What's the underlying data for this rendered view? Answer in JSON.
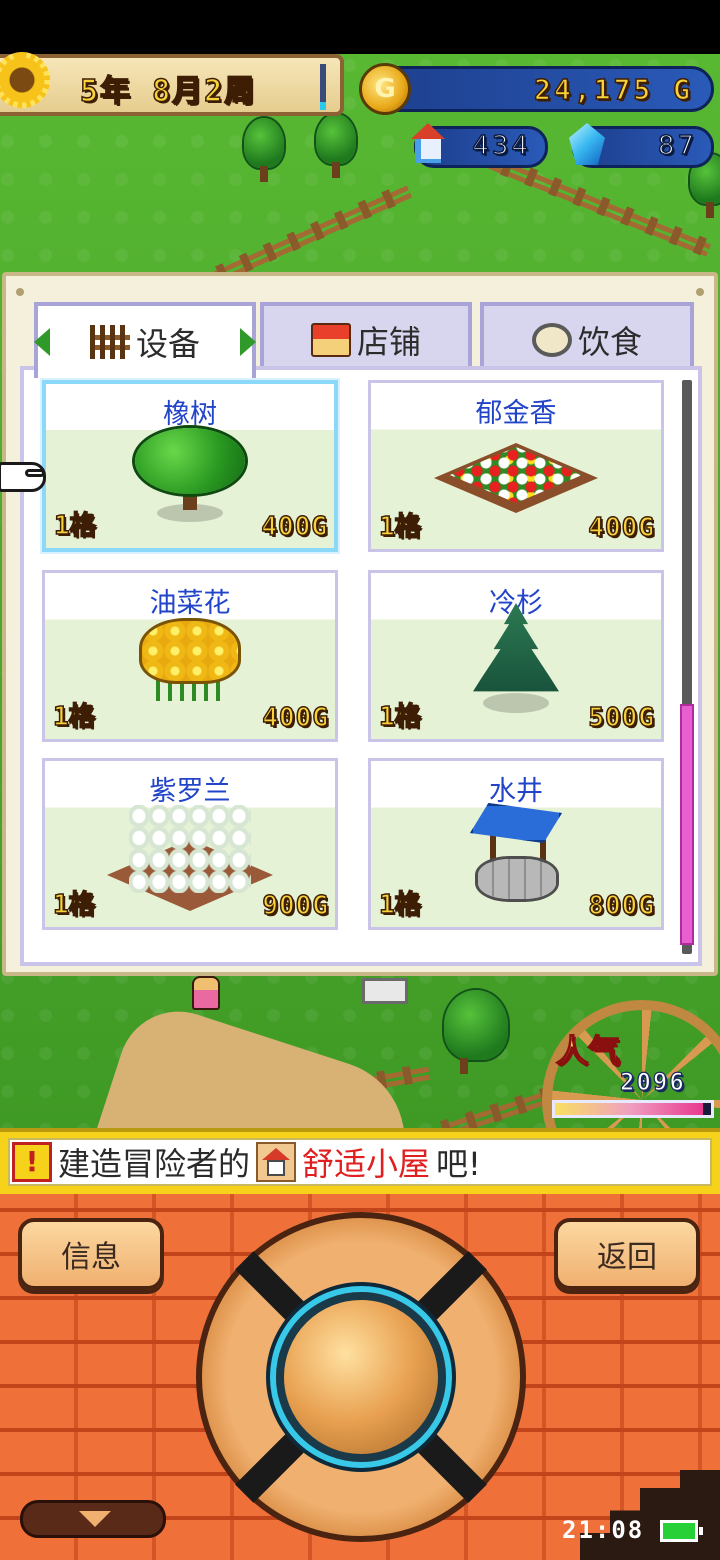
{
  "hud": {
    "date": "5年 8月2周",
    "gold": "24,175 G",
    "coin_symbol": "G",
    "rank": "434",
    "gems": "87"
  },
  "tabs": [
    {
      "label": "设备",
      "icon": "fence-icon",
      "active": true
    },
    {
      "label": "店铺",
      "icon": "shop-icon",
      "active": false
    },
    {
      "label": "饮食",
      "icon": "food-icon",
      "active": false
    }
  ],
  "items": [
    {
      "name": "橡树",
      "size": "1格",
      "price": "400G",
      "icon": "oak-tree-icon",
      "selected": true
    },
    {
      "name": "郁金香",
      "size": "1格",
      "price": "400G",
      "icon": "tulip-bed-icon"
    },
    {
      "name": "油菜花",
      "size": "1格",
      "price": "400G",
      "icon": "rape-flower-icon"
    },
    {
      "name": "冷杉",
      "size": "1格",
      "price": "500G",
      "icon": "fir-tree-icon"
    },
    {
      "name": "紫罗兰",
      "size": "1格",
      "price": "900G",
      "icon": "violet-bed-icon"
    },
    {
      "name": "水井",
      "size": "1格",
      "price": "800G",
      "icon": "well-icon"
    }
  ],
  "scroll": {
    "position": 0.55,
    "visible_fraction": 0.42
  },
  "popularity": {
    "label": "人气",
    "value": "2096",
    "level": 0.95
  },
  "message": {
    "prefix": "建造冒险者的",
    "highlight": "舒适小屋",
    "suffix": "吧!"
  },
  "buttons": {
    "info": "信息",
    "back": "返回"
  },
  "status": {
    "time": "21:08"
  },
  "colors": {
    "item_name": "#2244c8",
    "highlight": "#e02020",
    "message_bar": "#f7d21a",
    "brick": "#f0703a"
  }
}
